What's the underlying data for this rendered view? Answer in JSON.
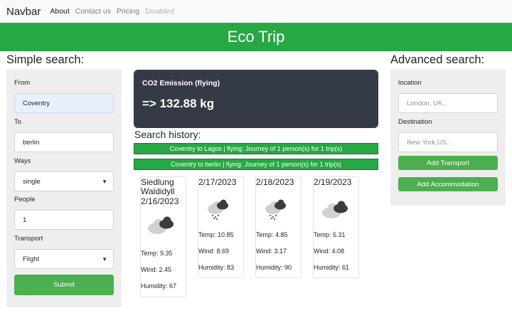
{
  "navbar": {
    "brand": "Navbar",
    "links": [
      "About",
      "Contact us",
      "Pricing",
      "Disabled"
    ]
  },
  "hero": {
    "title": "Eco Trip"
  },
  "simple_search": {
    "title": "Simple search:",
    "from_label": "From",
    "from_value": "Coventry",
    "to_label": "To",
    "to_value": "berlin",
    "ways_label": "Ways",
    "ways_value": "single",
    "people_label": "People",
    "people_value": "1",
    "transport_label": "Transport",
    "transport_value": "Flight",
    "submit_label": "Submit"
  },
  "co2": {
    "title": "CO2 Emission (flying)",
    "value": "=> 132.88 kg"
  },
  "history": {
    "title": "Search history:",
    "items": [
      "Coventry to Lagos | flying: Journey of 1 person(s) for 1 trip(s)",
      "Coventry to berlin | flying: Journey of 1 person(s) for 1 trip(s)"
    ]
  },
  "weather": [
    {
      "title_line1": "Siedlung",
      "title_line2": "Waldidyll",
      "title_line3": "2/16/2023",
      "icon": "cloudy-icon",
      "temp": "Temp: 9.35",
      "wind": "Wind: 2.45",
      "humidity": "Humidity: 67"
    },
    {
      "title_line1": "2/17/2023",
      "icon": "rain-cloud-icon",
      "temp": "Temp: 10.85",
      "wind": "Wind: 8.69",
      "humidity": "Humidity: 83"
    },
    {
      "title_line1": "2/18/2023",
      "icon": "rain-cloud-icon",
      "temp": "Temp: 4.85",
      "wind": "Wind: 3.17",
      "humidity": "Humidity: 90"
    },
    {
      "title_line1": "2/19/2023",
      "icon": "cloudy-icon",
      "temp": "Temp: 5.31",
      "wind": "Wind: 4.08",
      "humidity": "Humidity: 61"
    }
  ],
  "advanced_search": {
    "title": "Advanced search:",
    "location_label": "location",
    "location_placeholder": "London, UK..",
    "destination_label": "Destination",
    "destination_placeholder": "New York,US..",
    "add_transport_label": "Add Transport",
    "add_accommodation_label": "Add Accommodation"
  },
  "colors": {
    "accent_green": "#28a745",
    "button_green": "#4caf50",
    "co2_card_bg": "#343a46"
  }
}
